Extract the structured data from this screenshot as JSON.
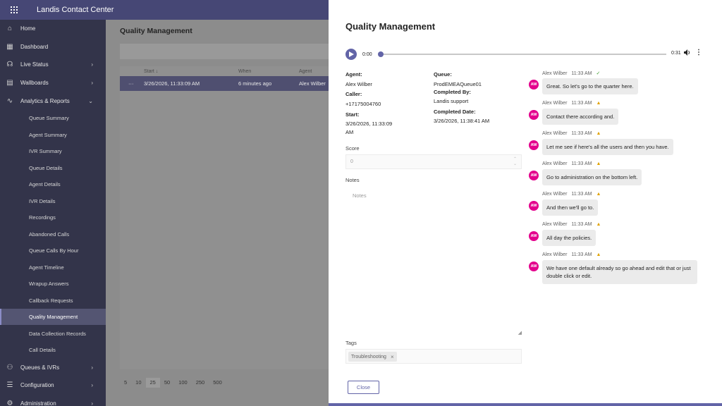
{
  "app": {
    "title": "Landis Contact Center",
    "waffle_icon": "waffle-icon"
  },
  "sidebar": {
    "items": [
      {
        "label": "Home",
        "icon": "home-icon"
      },
      {
        "label": "Dashboard",
        "icon": "dashboard-icon"
      },
      {
        "label": "Live Status",
        "icon": "headset-icon",
        "expandable": true
      },
      {
        "label": "Wallboards",
        "icon": "grid-icon",
        "expandable": true
      },
      {
        "label": "Analytics & Reports",
        "icon": "analytics-icon",
        "expanded": true
      }
    ],
    "subitems": [
      "Queue Summary",
      "Agent Summary",
      "IVR Summary",
      "Queue Details",
      "Agent Details",
      "IVR Details",
      "Recordings",
      "Abandoned Calls",
      "Queue Calls By Hour",
      "Agent Timeline",
      "Wrapup Answers",
      "Callback Requests",
      "Quality Management",
      "Data Collection Records",
      "Call Details"
    ],
    "active_subitem": "Quality Management",
    "bottom_items": [
      {
        "label": "Queues & IVRs",
        "icon": "people-icon"
      },
      {
        "label": "Configuration",
        "icon": "settings-list-icon"
      },
      {
        "label": "Administration",
        "icon": "admin-icon"
      }
    ]
  },
  "main": {
    "page_title": "Quality Management",
    "columns": [
      "Start ↓",
      "When",
      "Agent"
    ],
    "row": {
      "menu": "···",
      "start": "3/26/2026, 11:33:09 AM",
      "when": "6 minutes ago",
      "agent": "Alex Wilber"
    },
    "page_sizes": [
      "5",
      "10",
      "25",
      "50",
      "100",
      "250",
      "500"
    ],
    "selected_page_size": "25"
  },
  "panel": {
    "title": "Quality Management",
    "player": {
      "current": "0:00",
      "duration": "0:31",
      "progress": 0.0
    },
    "agent_label": "Agent:",
    "agent": "Alex Wilber",
    "caller_label": "Caller:",
    "caller": "+17175004760",
    "start_label": "Start:",
    "start_line1": "3/26/2026, 11:33:09",
    "start_line2": "AM",
    "queue_label": "Queue:",
    "queue": "ProdEMEAQueue01",
    "completed_by_label": "Completed By:",
    "completed_by": "Landis support",
    "completed_date_label": "Completed Date:",
    "completed_date": "3/26/2026, 11:38:41 AM",
    "score_label": "Score",
    "score_value": "0",
    "notes_label": "Notes",
    "notes_placeholder": "Notes",
    "tags_label": "Tags",
    "tags": [
      "Troubleshooting"
    ],
    "close_label": "Close"
  },
  "transcript": [
    {
      "speaker": "Alex Wilber",
      "time": "11:33 AM",
      "status": "ok",
      "initials": "AW",
      "text": "Great. So let's go to the quarter here."
    },
    {
      "speaker": "Alex Wilber",
      "time": "11:33 AM",
      "status": "warn",
      "initials": "AW",
      "text": "Contact there according and."
    },
    {
      "speaker": "Alex Wilber",
      "time": "11:33 AM",
      "status": "warn",
      "initials": "AW",
      "text": "Let me see if here's all the users and then you have."
    },
    {
      "speaker": "Alex Wilber",
      "time": "11:33 AM",
      "status": "warn",
      "initials": "AW",
      "text": "Go to administration on the bottom left."
    },
    {
      "speaker": "Alex Wilber",
      "time": "11:33 AM",
      "status": "warn",
      "initials": "AW",
      "text": "And then we'll go to."
    },
    {
      "speaker": "Alex Wilber",
      "time": "11:33 AM",
      "status": "warn",
      "initials": "AW",
      "text": "All day the policies."
    },
    {
      "speaker": "Alex Wilber",
      "time": "11:33 AM",
      "status": "warn",
      "initials": "AW",
      "text": "We have one default already so go ahead and edit that or just double click or edit."
    }
  ],
  "colors": {
    "brand": "#6264a7",
    "topbar": "#464775",
    "sidebar": "#33344a",
    "avatar": "#e3008c",
    "ok": "#3a9d2b",
    "warn": "#e0a200"
  }
}
